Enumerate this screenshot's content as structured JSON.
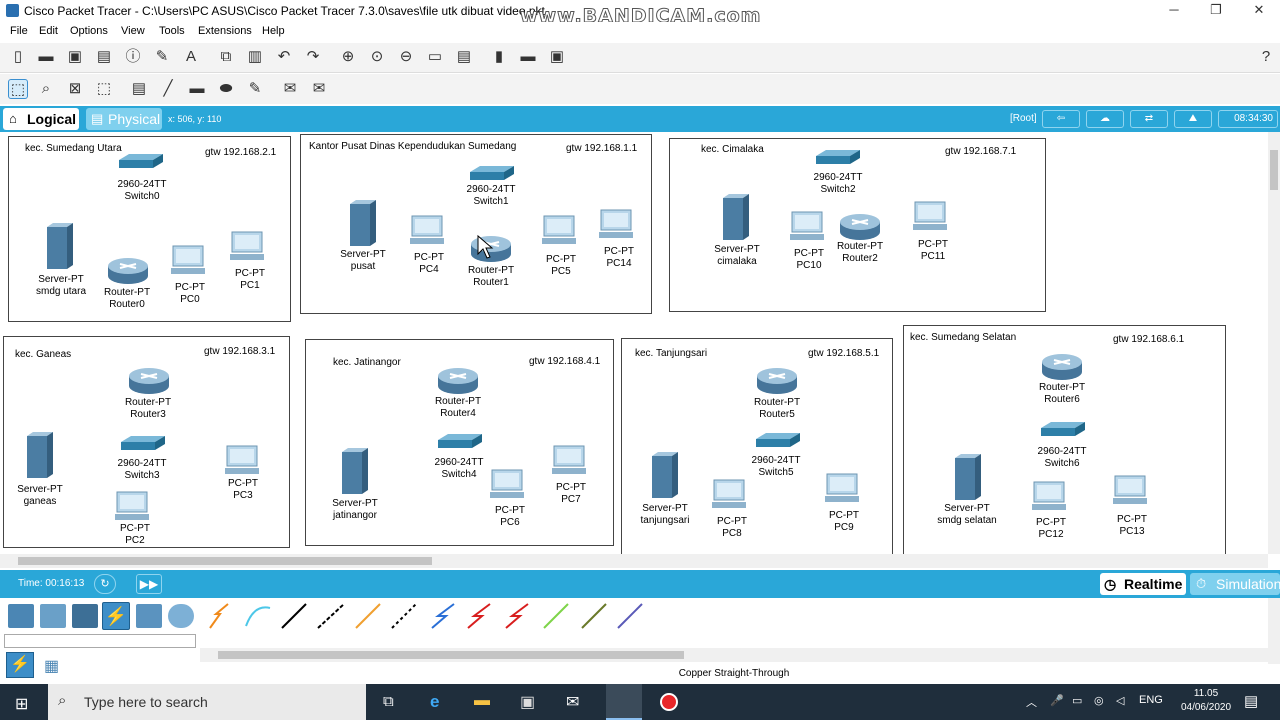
{
  "window": {
    "title": "Cisco Packet Tracer - C:\\Users\\PC ASUS\\Cisco Packet Tracer 7.3.0\\saves\\file utk dibuat video.pkt",
    "watermark": "www.BANDICAM.com"
  },
  "menu": [
    "File",
    "Edit",
    "Options",
    "View",
    "Tools",
    "Extensions",
    "Help"
  ],
  "modebar": {
    "logical": "Logical",
    "physical": "Physical",
    "coords": "x: 506, y: 110",
    "root": "[Root]",
    "clock": "08:34:30"
  },
  "zones": [
    {
      "name": "kec. Sumedang Utara",
      "gateway": "gtw 192.168.2.1"
    },
    {
      "name": "Kantor Pusat Dinas Kependudukan Sumedang",
      "gateway": "gtw 192.168.1.1"
    },
    {
      "name": "kec. Cimalaka",
      "gateway": "gtw 192.168.7.1"
    },
    {
      "name": "kec. Ganeas",
      "gateway": "gtw 192.168.3.1"
    },
    {
      "name": "kec. Jatinangor",
      "gateway": "gtw 192.168.4.1"
    },
    {
      "name": "kec. Tanjungsari",
      "gateway": "gtw 192.168.5.1"
    },
    {
      "name": "kec. Sumedang Selatan",
      "gateway": "gtw 192.168.6.1"
    }
  ],
  "devices": {
    "sw_utara": [
      "2960-24TT",
      "Switch0"
    ],
    "srv_utara": [
      "Server-PT",
      "smdg utara"
    ],
    "rt_utara": [
      "Router-PT",
      "Router0"
    ],
    "pc0": [
      "PC-PT",
      "PC0"
    ],
    "pc1": [
      "PC-PT",
      "PC1"
    ],
    "sw_pusat": [
      "2960-24TT",
      "Switch1"
    ],
    "srv_pusat": [
      "Server-PT",
      "pusat"
    ],
    "pc4": [
      "PC-PT",
      "PC4"
    ],
    "rt_pusat": [
      "Router-PT",
      "Router1"
    ],
    "pc5": [
      "PC-PT",
      "PC5"
    ],
    "pc14": [
      "PC-PT",
      "PC14"
    ],
    "sw_cim": [
      "2960-24TT",
      "Switch2"
    ],
    "srv_cim": [
      "Server-PT",
      "cimalaka"
    ],
    "pc10": [
      "PC-PT",
      "PC10"
    ],
    "rt_cim": [
      "Router-PT",
      "Router2"
    ],
    "pc11": [
      "PC-PT",
      "PC11"
    ],
    "rt_gan": [
      "Router-PT",
      "Router3"
    ],
    "sw_gan": [
      "2960-24TT",
      "Switch3"
    ],
    "srv_gan": [
      "Server-PT",
      "ganeas"
    ],
    "pc3": [
      "PC-PT",
      "PC3"
    ],
    "pc2": [
      "PC-PT",
      "PC2"
    ],
    "rt_jat": [
      "Router-PT",
      "Router4"
    ],
    "sw_jat": [
      "2960-24TT",
      "Switch4"
    ],
    "srv_jat": [
      "Server-PT",
      "jatinangor"
    ],
    "pc7": [
      "PC-PT",
      "PC7"
    ],
    "pc6": [
      "PC-PT",
      "PC6"
    ],
    "rt_tan": [
      "Router-PT",
      "Router5"
    ],
    "sw_tan": [
      "2960-24TT",
      "Switch5"
    ],
    "srv_tan": [
      "Server-PT",
      "tanjungsari"
    ],
    "pc8": [
      "PC-PT",
      "PC8"
    ],
    "pc9": [
      "PC-PT",
      "PC9"
    ],
    "rt_sel": [
      "Router-PT",
      "Router6"
    ],
    "sw_sel": [
      "2960-24TT",
      "Switch6"
    ],
    "srv_sel": [
      "Server-PT",
      "smdg selatan"
    ],
    "pc12": [
      "PC-PT",
      "PC12"
    ],
    "pc13": [
      "PC-PT",
      "PC13"
    ]
  },
  "bottombar": {
    "time": "Time: 00:16:13",
    "realtime": "Realtime",
    "simulation": "Simulation"
  },
  "cable_status": "Copper Straight-Through",
  "taskbar": {
    "search_placeholder": "Type here to search",
    "lang": "ENG",
    "time": "11.05",
    "date": "04/06/2020"
  },
  "colors": {
    "accent": "#2aa7d8",
    "link_up": "#3db23d",
    "link_red": "#d81e1e"
  }
}
